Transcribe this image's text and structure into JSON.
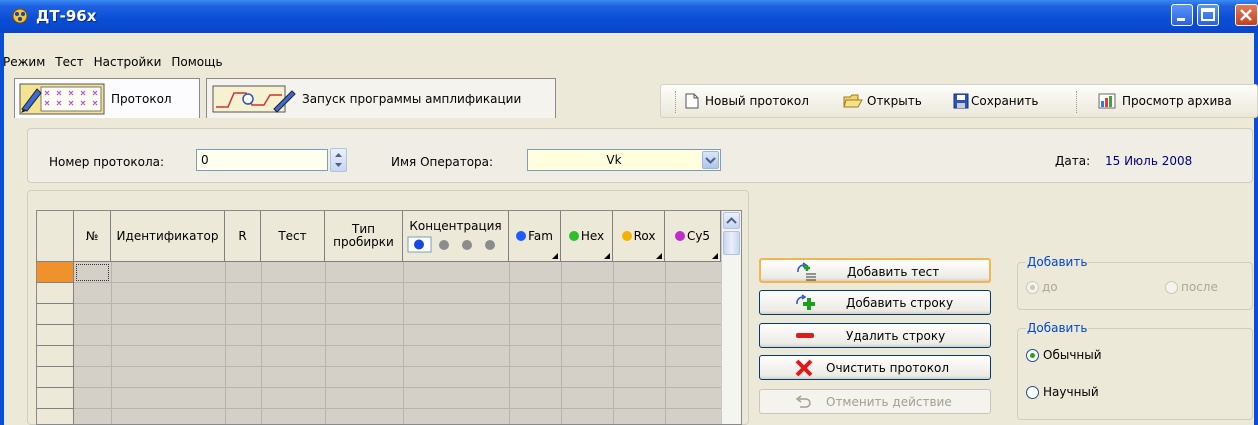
{
  "window": {
    "title": "ДТ-96х",
    "accent": "#0A4DD6"
  },
  "menu": {
    "items": [
      "Режим",
      "Тест",
      "Настройки",
      "Помощь"
    ]
  },
  "tabs": [
    {
      "label": "Протокол",
      "icon": "protocol-grid-icon",
      "selected": true
    },
    {
      "label": "Запуск программы амплификации",
      "icon": "amplification-icon",
      "selected": false
    }
  ],
  "toolbar": {
    "new_protocol": "Новый протокол",
    "open": "Открыть",
    "save": "Сохранить",
    "view_archive": "Просмотр архива"
  },
  "form": {
    "protocol_number_label": "Номер протокола:",
    "protocol_number_value": "0",
    "operator_label": "Имя Оператора:",
    "operator_value": "Vk",
    "date_label": "Дата:",
    "date_value": "15 Июль 2008"
  },
  "grid": {
    "columns": [
      {
        "label": "№"
      },
      {
        "label": "Идентификатор"
      },
      {
        "label": "R"
      },
      {
        "label": "Тест"
      },
      {
        "label": "Тип пробирки"
      },
      {
        "label": "Концентрация"
      },
      {
        "label": "Fam",
        "color": "#1E5BFF"
      },
      {
        "label": "Hex",
        "color": "#2DBE2D"
      },
      {
        "label": "Rox",
        "color": "#F5B400"
      },
      {
        "label": "Cy5",
        "color": "#C02CC8"
      }
    ],
    "selected_row_color": "#F0922B"
  },
  "actions": {
    "add_test": "Добавить тест",
    "add_row": "Добавить строку",
    "delete_row": "Удалить строку",
    "clear_protocol": "Очистить протокол",
    "undo": "Отменить действие"
  },
  "position_group": {
    "title": "Добавить",
    "before": "до",
    "after": "после",
    "selected": "before",
    "enabled": false
  },
  "mode_group": {
    "title": "Добавить",
    "normal": "Обычный",
    "scientific": "Научный",
    "selected": "normal"
  }
}
